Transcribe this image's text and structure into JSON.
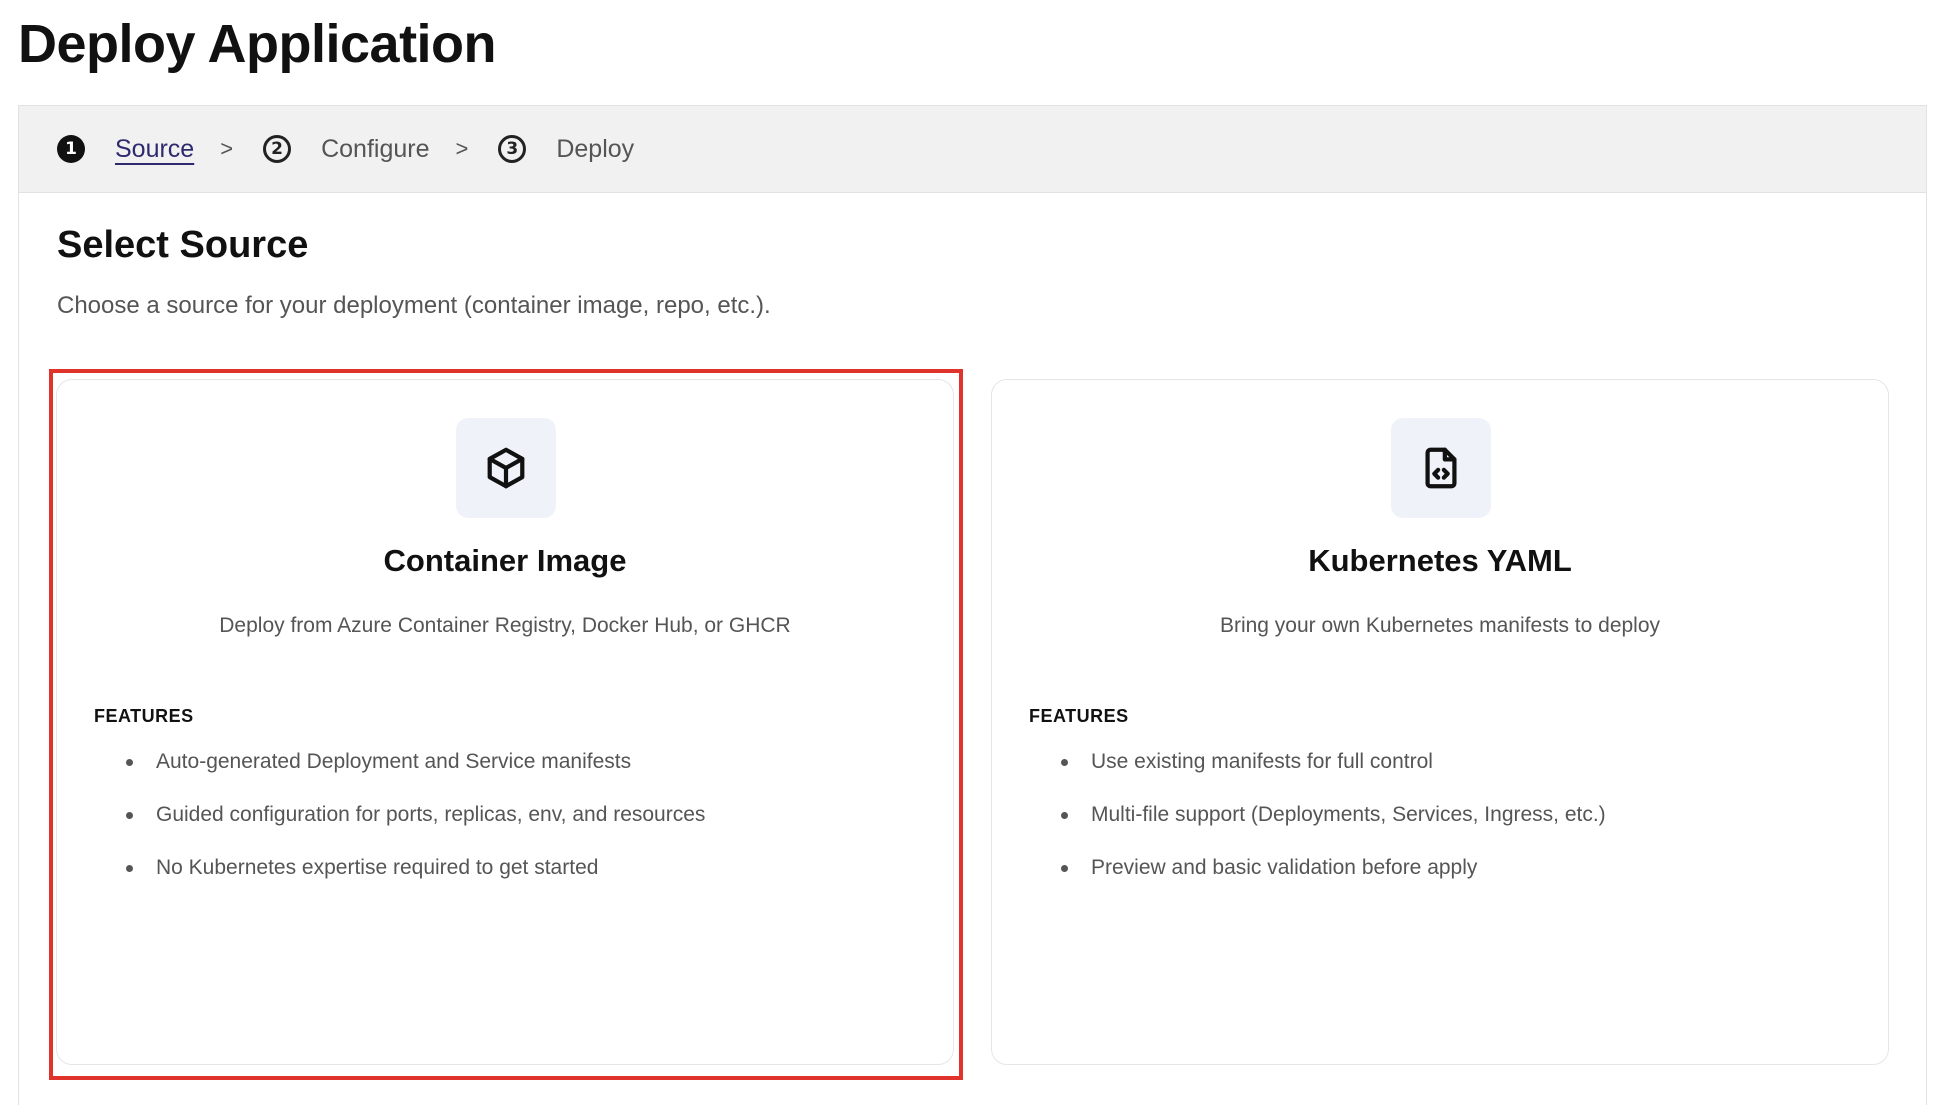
{
  "page": {
    "title": "Deploy Application"
  },
  "stepper": {
    "separator": ">",
    "steps": [
      {
        "number": "1",
        "label": "Source",
        "active": true
      },
      {
        "number": "2",
        "label": "Configure",
        "active": false
      },
      {
        "number": "3",
        "label": "Deploy",
        "active": false
      }
    ]
  },
  "section": {
    "title": "Select Source",
    "description": "Choose a source for your deployment (container image, repo, etc.)."
  },
  "cards": [
    {
      "icon": "cube-icon",
      "title": "Container Image",
      "description": "Deploy from Azure Container Registry, Docker Hub, or GHCR",
      "features_label": "FEATURES",
      "features": [
        "Auto-generated Deployment and Service manifests",
        "Guided configuration for ports, replicas, env, and resources",
        "No Kubernetes expertise required to get started"
      ],
      "selected": true
    },
    {
      "icon": "code-file-icon",
      "title": "Kubernetes YAML",
      "description": "Bring your own Kubernetes manifests to deploy",
      "features_label": "FEATURES",
      "features": [
        "Use existing manifests for full control",
        "Multi-file support (Deployments, Services, Ingress, etc.)",
        "Preview and basic validation before apply"
      ],
      "selected": false
    }
  ],
  "colors": {
    "highlight": "#e0332b",
    "active_step_link": "#2e2a6e",
    "icon_tile": "#eff3f9",
    "stepper_bg": "#f1f1f1"
  }
}
